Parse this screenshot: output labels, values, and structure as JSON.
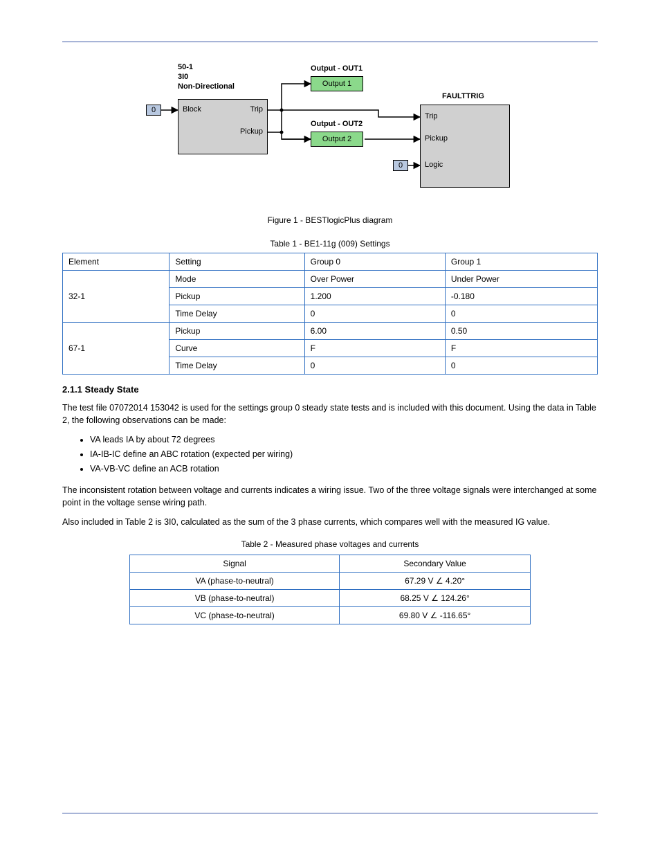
{
  "diagram": {
    "block50": {
      "header1": "50-1",
      "header2": "3I0",
      "header3": "Non-Directional",
      "in_block": "Block",
      "out_trip": "Trip",
      "out_pickup": "Pickup",
      "const": "0"
    },
    "out1": {
      "header": "Output - OUT1",
      "label": "Output 1"
    },
    "out2": {
      "header": "Output - OUT2",
      "label": "Output 2"
    },
    "fault": {
      "header": "FAULTTRIG",
      "in_trip": "Trip",
      "in_pickup": "Pickup",
      "in_logic": "Logic",
      "const": "0"
    }
  },
  "figure_caption": "Figure 1 - BESTlogicPlus diagram",
  "table1": {
    "title": "Table 1 - BE1-11g (009) Settings",
    "headers": [
      "Element",
      "Setting",
      "Group 0",
      "Group 1"
    ],
    "rows": [
      {
        "elem": "32-1",
        "cells": [
          [
            "Mode",
            "Over Power",
            "Under Power"
          ],
          [
            "Pickup",
            "1.200",
            "-0.180"
          ],
          [
            "Time Delay",
            "0",
            "0"
          ]
        ]
      },
      {
        "elem": "67-1",
        "cells": [
          [
            "Pickup",
            "6.00",
            "0.50"
          ],
          [
            "Curve",
            "F",
            "F"
          ],
          [
            "Time Delay",
            "0",
            "0"
          ]
        ]
      }
    ]
  },
  "section211": {
    "heading": "2.1.1  Steady State",
    "p1": "The test file 07072014 153042 is used for the settings group 0 steady state tests and is included with this document. Using the data in Table 2, the following observations can be made:",
    "bullets": [
      "VA leads IA by about 72 degrees",
      "IA-IB-IC define an ABC rotation (expected per wiring)",
      "VA-VB-VC define an ACB rotation"
    ],
    "p2": "The inconsistent rotation between voltage and currents indicates a wiring issue. Two of the three voltage signals were interchanged at some point in the voltage sense wiring path.",
    "p3": "Also included in Table 2 is 3I0, calculated as the sum of the 3 phase currents, which compares well with the measured IG value."
  },
  "table2": {
    "title": "Table 2 - Measured phase voltages and currents",
    "headers": [
      "Signal",
      "Secondary Value"
    ],
    "rows": [
      [
        "VA (phase-to-neutral)",
        "67.29 V ∠ 4.20°"
      ],
      [
        "VB (phase-to-neutral)",
        "68.25 V ∠ 124.26°"
      ],
      [
        "VC (phase-to-neutral)",
        "69.80 V ∠ -116.65°"
      ]
    ]
  }
}
